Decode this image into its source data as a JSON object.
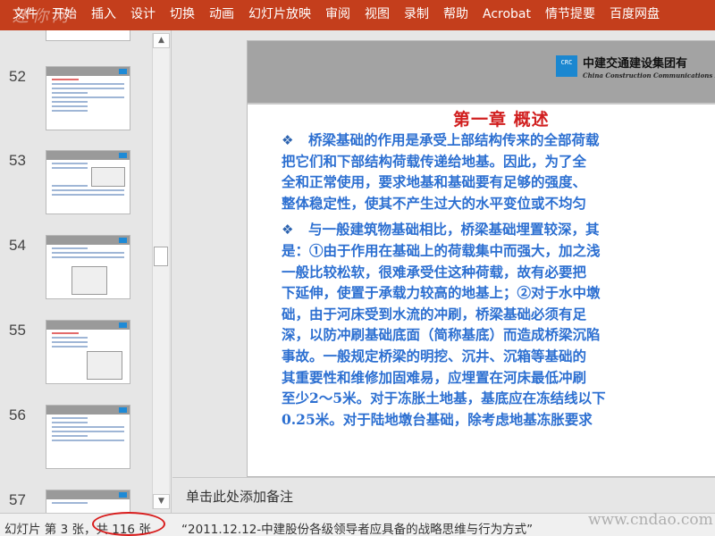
{
  "ribbon": {
    "tabs": [
      "文件",
      "开始",
      "插入",
      "设计",
      "切换",
      "动画",
      "幻灯片放映",
      "审阅",
      "视图",
      "录制",
      "帮助",
      "Acrobat",
      "情节提要",
      "百度网盘"
    ],
    "watermark": "迷你网"
  },
  "thumbnails": [
    {
      "number": "52"
    },
    {
      "number": "53"
    },
    {
      "number": "54"
    },
    {
      "number": "55"
    },
    {
      "number": "56"
    },
    {
      "number": "57"
    }
  ],
  "slide": {
    "company_cn": "中建交通建设集团有",
    "company_en": "China Construction Communications Engineer",
    "logo_text": "CRC",
    "chapter_title": "第一章  概述",
    "bullet_glyph": "❖",
    "paragraphs": [
      {
        "lines": [
          "桥梁基础的作用是承受上部结构传来的全部荷载",
          "把它们和下部结构荷载传递给地基。因此，为了全",
          "全和正常使用，要求地基和基础要有足够的强度、",
          "整体稳定性，使其不产生过大的水平变位或不均匀"
        ]
      },
      {
        "lines": [
          "与一般建筑物基础相比，桥梁基础埋置较深，其",
          "是：①由于作用在基础上的荷载集中而强大，加之浅",
          "一般比较松软，很难承受住这种荷载，故有必要把",
          "下延伸，使置于承载力较高的地基上；②对于水中墩",
          "础，由于河床受到水流的冲刷，桥梁基础必须有足",
          "深，以防冲刷基础底面（简称基底）而造成桥梁沉陷",
          "事故。一般规定桥梁的明挖、沉井、沉箱等基础的",
          "其重要性和维修加固难易，应埋置在河床最低冲刷",
          "至少2～5米。对于冻胀土地基，基底应在冻结线以下",
          "0.25米。对于陆地墩台基础，除考虑地基冻胀要求"
        ]
      }
    ]
  },
  "notes": {
    "placeholder": "单击此处添加备注"
  },
  "status": {
    "slide_info": "幻灯片 第 3 张，共 116 张",
    "file_name": "“2011.12.12-中建股份各级领导者应具备的战略思维与行为方式”",
    "watermark": "www.cndao.com"
  },
  "colors": {
    "ribbon": "#c43e1c",
    "title_red": "#d11f1f",
    "body_blue": "#2c6fd1",
    "logo_blue": "#1b87d0"
  }
}
